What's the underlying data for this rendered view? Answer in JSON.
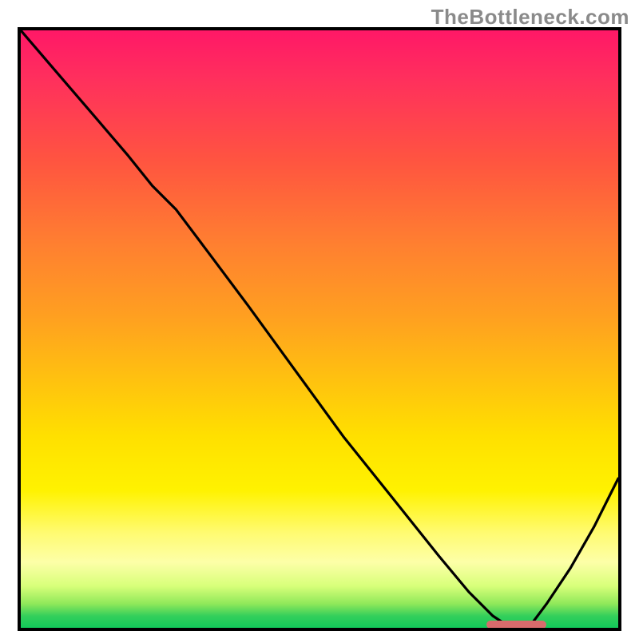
{
  "watermark": "TheBottleneck.com",
  "chart_data": {
    "type": "line",
    "title": "",
    "xlabel": "",
    "ylabel": "",
    "xlim": [
      0,
      100
    ],
    "ylim": [
      0,
      100
    ],
    "grid": false,
    "legend": false,
    "background": "rainbow-gradient-vertical",
    "series": [
      {
        "name": "bottleneck-curve",
        "x": [
          0,
          6,
          12,
          18,
          22,
          26,
          32,
          38,
          46,
          54,
          62,
          70,
          75,
          79,
          82,
          85,
          88,
          92,
          96,
          100
        ],
        "y": [
          100,
          93,
          86,
          79,
          74,
          70,
          62,
          54,
          43,
          32,
          22,
          12,
          6,
          2,
          0,
          0,
          4,
          10,
          17,
          25
        ]
      }
    ],
    "annotations": [
      {
        "name": "optimal-marker",
        "type": "bar-marker",
        "color": "#d96b6c",
        "x_start": 78,
        "x_end": 88,
        "y": 0.5
      }
    ]
  }
}
